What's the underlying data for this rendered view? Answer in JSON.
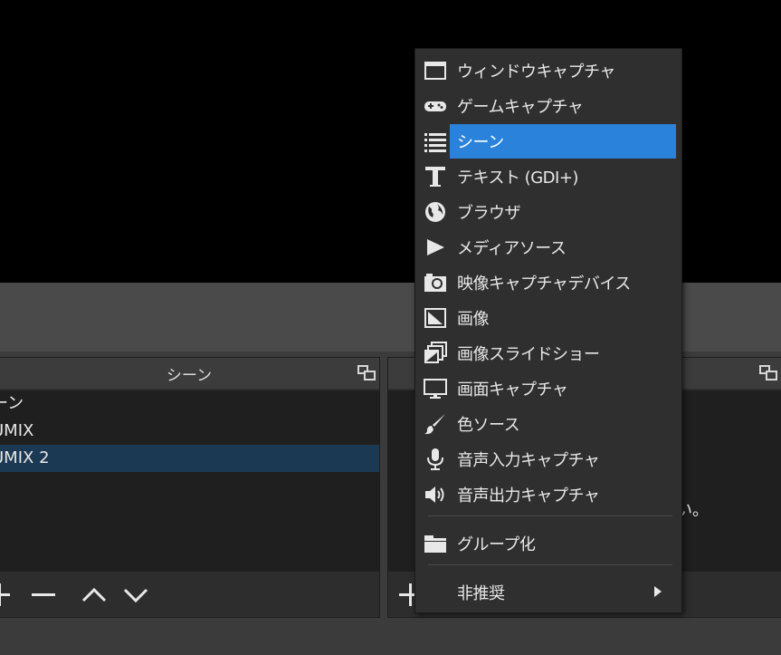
{
  "scenes_dock": {
    "title": "シーン",
    "items": [
      {
        "label": "ーン",
        "selected": false
      },
      {
        "label": "UMIX",
        "selected": false
      },
      {
        "label": "UMIX 2",
        "selected": true
      }
    ],
    "controls": [
      "add-icon",
      "remove-icon",
      "move-up-icon",
      "move-down-icon"
    ]
  },
  "sources_dock": {
    "hint_text": "さい。",
    "controls": [
      "add-icon"
    ]
  },
  "context_menu": {
    "items": [
      {
        "label": "ウィンドウキャプチャ",
        "icon": "window-icon"
      },
      {
        "label": "ゲームキャプチャ",
        "icon": "gamepad-icon"
      },
      {
        "label": "シーン",
        "icon": "list-icon",
        "highlighted": true
      },
      {
        "label": "テキスト (GDI+)",
        "icon": "text-icon"
      },
      {
        "label": "ブラウザ",
        "icon": "globe-icon"
      },
      {
        "label": "メディアソース",
        "icon": "play-icon"
      },
      {
        "label": "映像キャプチャデバイス",
        "icon": "camera-icon"
      },
      {
        "label": "画像",
        "icon": "image-icon"
      },
      {
        "label": "画像スライドショー",
        "icon": "slideshow-icon"
      },
      {
        "label": "画面キャプチャ",
        "icon": "monitor-icon"
      },
      {
        "label": "色ソース",
        "icon": "brush-icon"
      },
      {
        "label": "音声入力キャプチャ",
        "icon": "microphone-icon"
      },
      {
        "label": "音声出力キャプチャ",
        "icon": "speaker-icon"
      }
    ],
    "group_item": {
      "label": "グループ化",
      "icon": "folder-icon"
    },
    "deprecated_item": {
      "label": "非推奨",
      "icon": "chevron-right-icon"
    }
  },
  "colors": {
    "highlight": "#2a82da",
    "selected_row": "#1c3954",
    "menu_bg": "#2f2f2f",
    "panel_bg": "#2d2d2d"
  }
}
